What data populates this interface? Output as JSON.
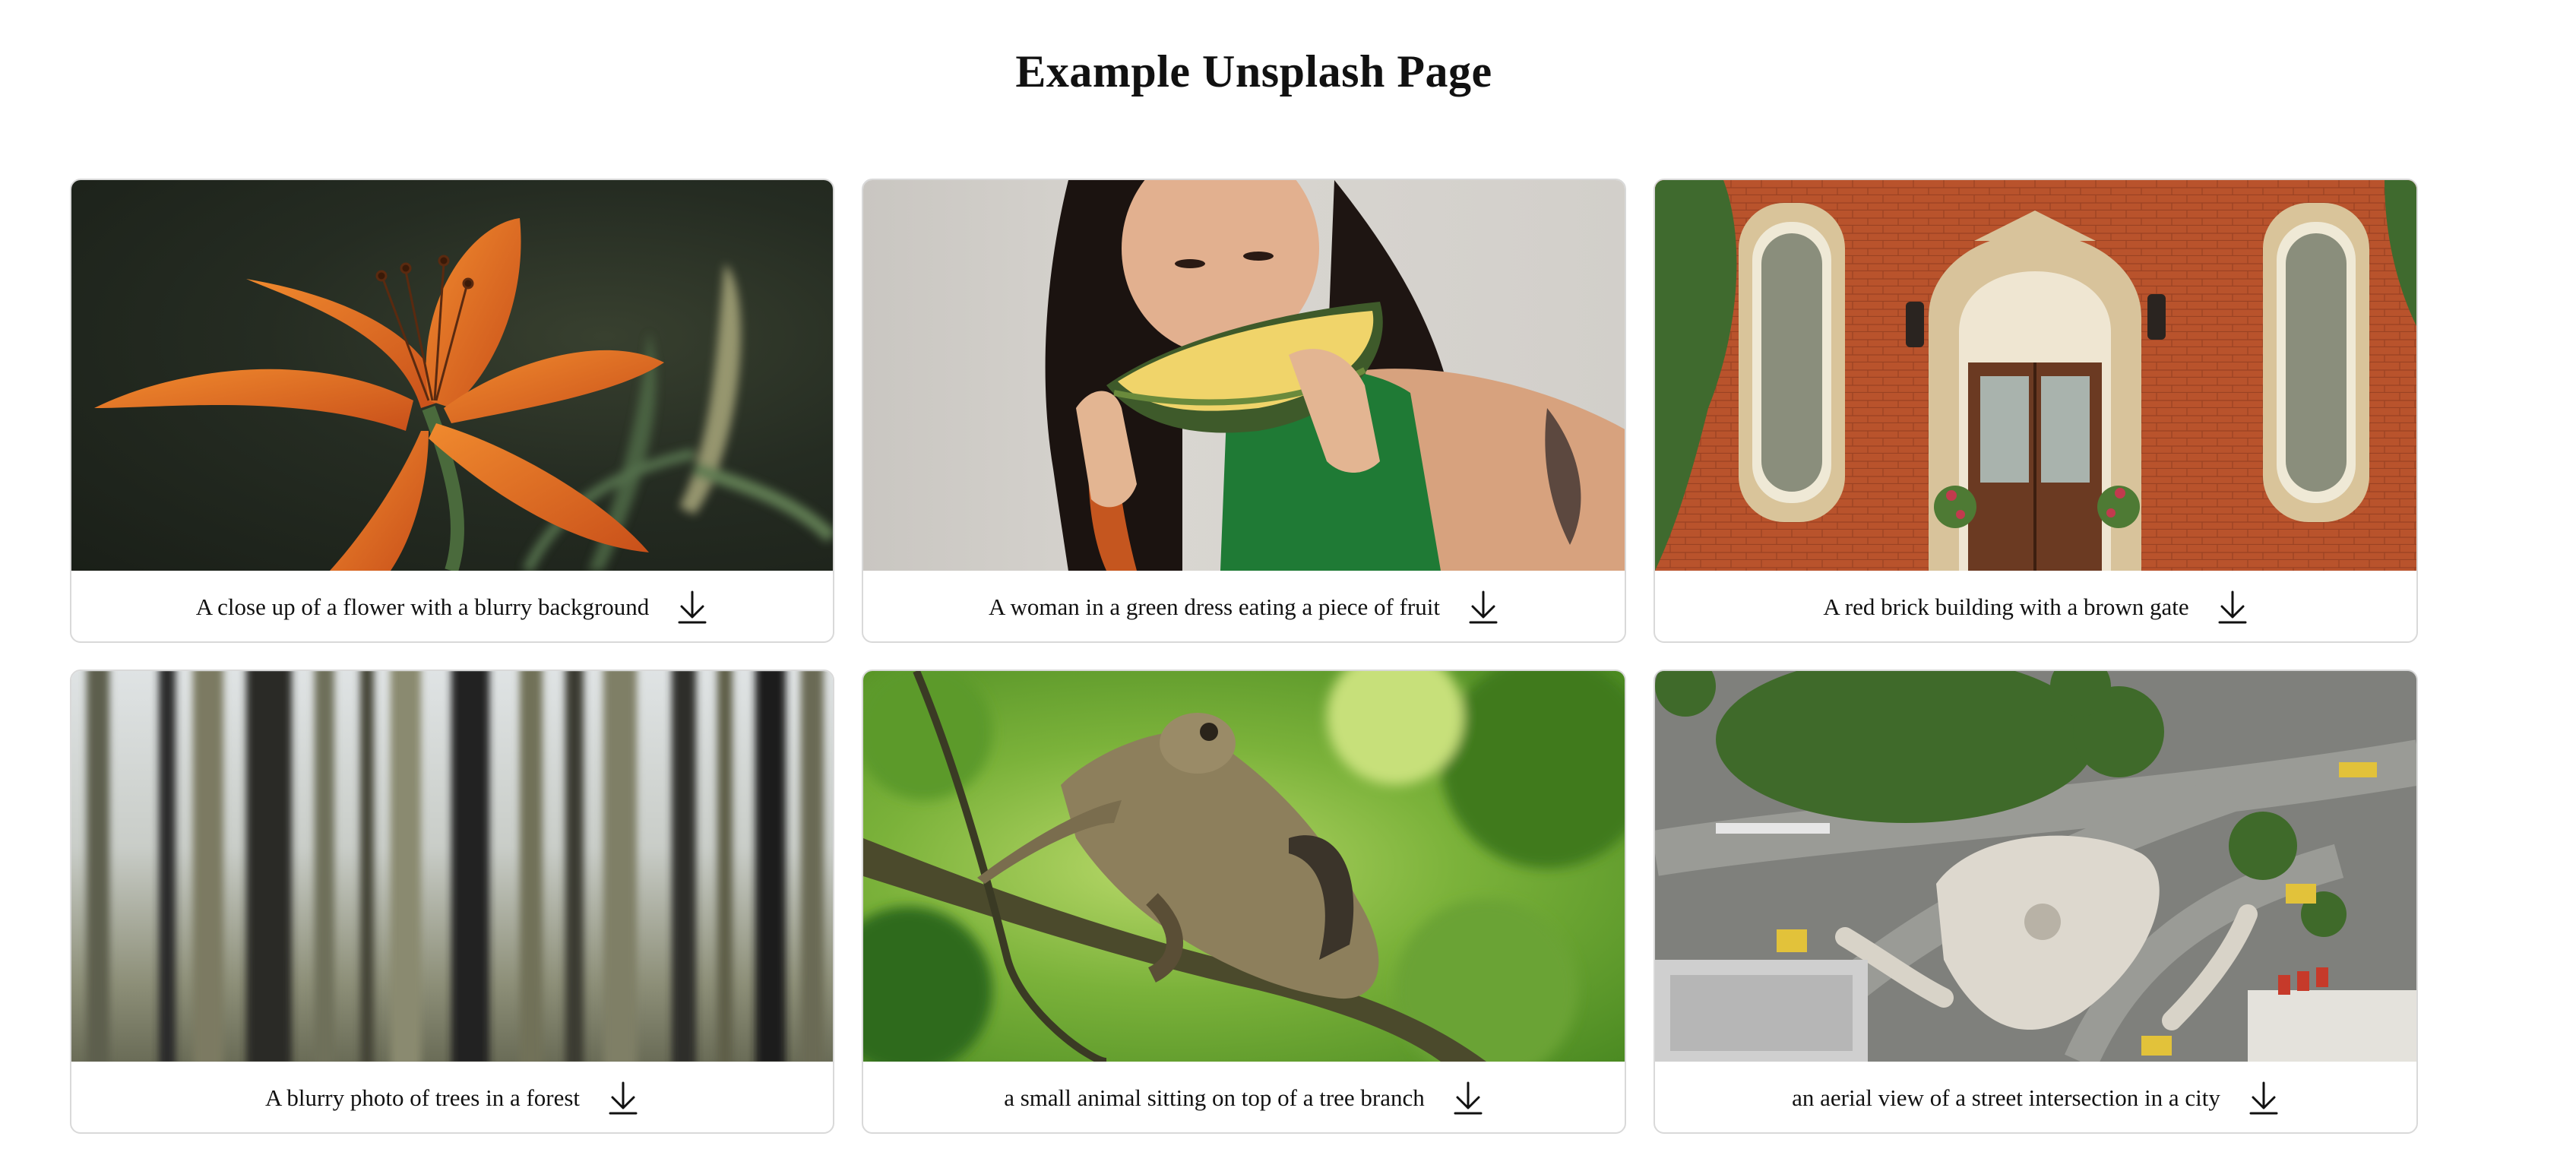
{
  "page": {
    "title": "Example Unsplash Page"
  },
  "cards": [
    {
      "caption": "A close up of a flower with a blurry background",
      "download_icon": "download-icon"
    },
    {
      "caption": "A woman in a green dress eating a piece of fruit",
      "download_icon": "download-icon"
    },
    {
      "caption": "A red brick building with a brown gate",
      "download_icon": "download-icon"
    },
    {
      "caption": "A blurry photo of trees in a forest",
      "download_icon": "download-icon"
    },
    {
      "caption": "a small animal sitting on top of a tree branch",
      "download_icon": "download-icon"
    },
    {
      "caption": "an aerial view of a street intersection in a city",
      "download_icon": "download-icon"
    }
  ],
  "colors": {
    "card_border": "#d9d9d9",
    "background": "#ffffff",
    "text": "#111111"
  }
}
